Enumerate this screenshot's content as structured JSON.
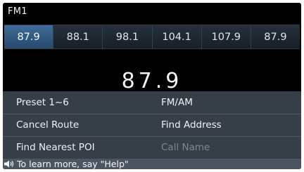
{
  "header": {
    "title": "FM1"
  },
  "presets": [
    "87.9",
    "88.1",
    "98.1",
    "104.1",
    "107.9",
    "87.9"
  ],
  "selected_preset_index": 0,
  "now_playing": {
    "frequency": "87.9"
  },
  "menu": {
    "rows": [
      {
        "left": "Preset 1~6",
        "right": "FM/AM"
      },
      {
        "left": "Cancel Route",
        "right": "Find Address"
      },
      {
        "left": "Find Nearest POI",
        "right": "Call Name"
      }
    ],
    "disabled": [
      "Call Name"
    ]
  },
  "hint": {
    "text": "To learn more, say \"Help\"",
    "icon": "speaker-icon"
  },
  "colors": {
    "background": "#000000",
    "selected_preset": "#3a6690",
    "menu_overlay": "#3a434d",
    "hint_bar": "#4a5561",
    "disabled_text": "#7e8791"
  }
}
